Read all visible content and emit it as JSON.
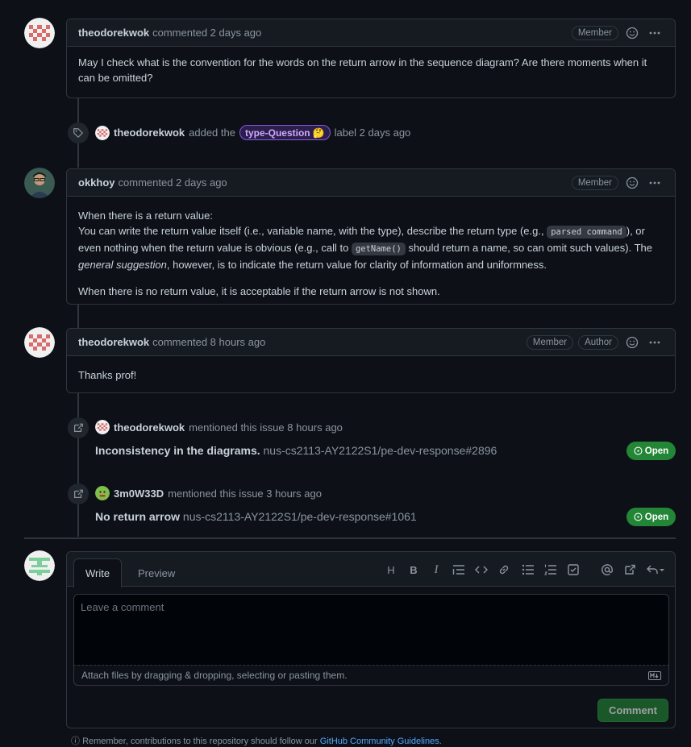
{
  "comments": [
    {
      "author": "theodorekwok",
      "action": "commented 2 days ago",
      "badges": [
        "Member"
      ],
      "body": "May I check what is the convention for the words on the return arrow in the sequence diagram? Are there moments when it can be omitted?"
    },
    {
      "author": "okkhoy",
      "action": "commented 2 days ago",
      "badges": [
        "Member"
      ],
      "body_line1": "When there is a return value:",
      "body_line2a": "You can write the return value itself (i.e., variable name, with the type), describe the return type (e.g., ",
      "code1": "parsed command",
      "body_line2b": "), or even nothing when the return value is obvious (e.g., call to ",
      "code2": "getName()",
      "body_line2c": " should return a name, so can omit such values). The ",
      "em": "general suggestion",
      "body_line2d": ", however, is to indicate the return value for clarity of information and uniformness.",
      "body_para2": "When there is no return value, it is acceptable if the return arrow is not shown."
    },
    {
      "author": "theodorekwok",
      "action": "commented 8 hours ago",
      "badges": [
        "Member",
        "Author"
      ],
      "body": "Thanks prof!"
    }
  ],
  "label_event": {
    "who": "theodorekwok",
    "pre": "added the",
    "label": "type-Question",
    "label_emoji": "🤔",
    "post": "label 2 days ago",
    "icon": "tag-icon"
  },
  "mentions": [
    {
      "who": "theodorekwok",
      "text": "mentioned this issue 8 hours ago",
      "title": "Inconsistency in the diagrams.",
      "ref": "nus-cs2113-AY2122S1/pe-dev-response#2896",
      "state": "Open"
    },
    {
      "who": "3m0W33D",
      "text": "mentioned this issue 3 hours ago",
      "title": "No return arrow",
      "ref": "nus-cs2113-AY2122S1/pe-dev-response#1061",
      "state": "Open"
    }
  ],
  "editor": {
    "tab_write": "Write",
    "tab_preview": "Preview",
    "placeholder": "Leave a comment",
    "attach_text": "Attach files by dragging & dropping, selecting or pasting them.",
    "submit_label": "Comment",
    "toolbar": [
      "heading-icon",
      "bold-icon",
      "italic-icon",
      "quote-icon",
      "code-icon",
      "link-icon",
      "bullet-list-icon",
      "numbered-list-icon",
      "task-list-icon",
      "mention-icon",
      "reference-icon",
      "reply-icon"
    ]
  },
  "footer": {
    "text": "Remember, contributions to this repository should follow our ",
    "link": "GitHub Community Guidelines",
    "end": "."
  },
  "colors": {
    "background": "#0d1117",
    "border": "#30363d",
    "open_green": "#238636",
    "label_purple": "#d2a8ff",
    "link_blue": "#58a6ff"
  }
}
